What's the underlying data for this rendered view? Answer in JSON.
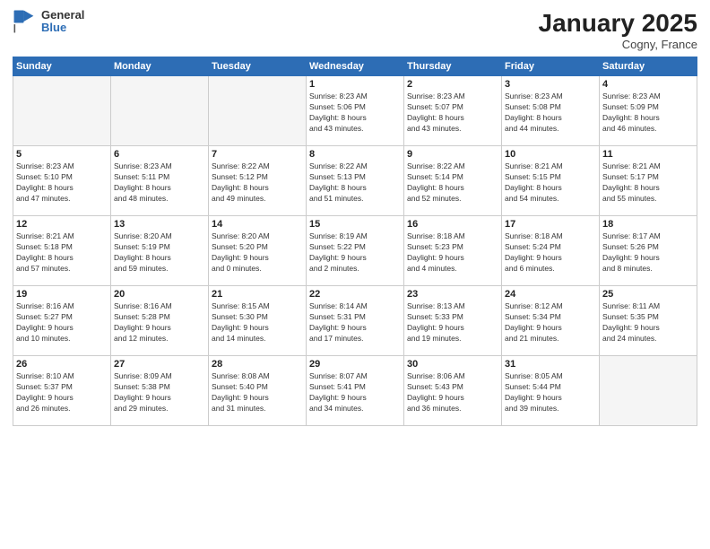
{
  "header": {
    "logo_general": "General",
    "logo_blue": "Blue",
    "month_title": "January 2025",
    "location": "Cogny, France"
  },
  "weekdays": [
    "Sunday",
    "Monday",
    "Tuesday",
    "Wednesday",
    "Thursday",
    "Friday",
    "Saturday"
  ],
  "weeks": [
    [
      {
        "day": "",
        "info": ""
      },
      {
        "day": "",
        "info": ""
      },
      {
        "day": "",
        "info": ""
      },
      {
        "day": "1",
        "info": "Sunrise: 8:23 AM\nSunset: 5:06 PM\nDaylight: 8 hours\nand 43 minutes."
      },
      {
        "day": "2",
        "info": "Sunrise: 8:23 AM\nSunset: 5:07 PM\nDaylight: 8 hours\nand 43 minutes."
      },
      {
        "day": "3",
        "info": "Sunrise: 8:23 AM\nSunset: 5:08 PM\nDaylight: 8 hours\nand 44 minutes."
      },
      {
        "day": "4",
        "info": "Sunrise: 8:23 AM\nSunset: 5:09 PM\nDaylight: 8 hours\nand 46 minutes."
      }
    ],
    [
      {
        "day": "5",
        "info": "Sunrise: 8:23 AM\nSunset: 5:10 PM\nDaylight: 8 hours\nand 47 minutes."
      },
      {
        "day": "6",
        "info": "Sunrise: 8:23 AM\nSunset: 5:11 PM\nDaylight: 8 hours\nand 48 minutes."
      },
      {
        "day": "7",
        "info": "Sunrise: 8:22 AM\nSunset: 5:12 PM\nDaylight: 8 hours\nand 49 minutes."
      },
      {
        "day": "8",
        "info": "Sunrise: 8:22 AM\nSunset: 5:13 PM\nDaylight: 8 hours\nand 51 minutes."
      },
      {
        "day": "9",
        "info": "Sunrise: 8:22 AM\nSunset: 5:14 PM\nDaylight: 8 hours\nand 52 minutes."
      },
      {
        "day": "10",
        "info": "Sunrise: 8:21 AM\nSunset: 5:15 PM\nDaylight: 8 hours\nand 54 minutes."
      },
      {
        "day": "11",
        "info": "Sunrise: 8:21 AM\nSunset: 5:17 PM\nDaylight: 8 hours\nand 55 minutes."
      }
    ],
    [
      {
        "day": "12",
        "info": "Sunrise: 8:21 AM\nSunset: 5:18 PM\nDaylight: 8 hours\nand 57 minutes."
      },
      {
        "day": "13",
        "info": "Sunrise: 8:20 AM\nSunset: 5:19 PM\nDaylight: 8 hours\nand 59 minutes."
      },
      {
        "day": "14",
        "info": "Sunrise: 8:20 AM\nSunset: 5:20 PM\nDaylight: 9 hours\nand 0 minutes."
      },
      {
        "day": "15",
        "info": "Sunrise: 8:19 AM\nSunset: 5:22 PM\nDaylight: 9 hours\nand 2 minutes."
      },
      {
        "day": "16",
        "info": "Sunrise: 8:18 AM\nSunset: 5:23 PM\nDaylight: 9 hours\nand 4 minutes."
      },
      {
        "day": "17",
        "info": "Sunrise: 8:18 AM\nSunset: 5:24 PM\nDaylight: 9 hours\nand 6 minutes."
      },
      {
        "day": "18",
        "info": "Sunrise: 8:17 AM\nSunset: 5:26 PM\nDaylight: 9 hours\nand 8 minutes."
      }
    ],
    [
      {
        "day": "19",
        "info": "Sunrise: 8:16 AM\nSunset: 5:27 PM\nDaylight: 9 hours\nand 10 minutes."
      },
      {
        "day": "20",
        "info": "Sunrise: 8:16 AM\nSunset: 5:28 PM\nDaylight: 9 hours\nand 12 minutes."
      },
      {
        "day": "21",
        "info": "Sunrise: 8:15 AM\nSunset: 5:30 PM\nDaylight: 9 hours\nand 14 minutes."
      },
      {
        "day": "22",
        "info": "Sunrise: 8:14 AM\nSunset: 5:31 PM\nDaylight: 9 hours\nand 17 minutes."
      },
      {
        "day": "23",
        "info": "Sunrise: 8:13 AM\nSunset: 5:33 PM\nDaylight: 9 hours\nand 19 minutes."
      },
      {
        "day": "24",
        "info": "Sunrise: 8:12 AM\nSunset: 5:34 PM\nDaylight: 9 hours\nand 21 minutes."
      },
      {
        "day": "25",
        "info": "Sunrise: 8:11 AM\nSunset: 5:35 PM\nDaylight: 9 hours\nand 24 minutes."
      }
    ],
    [
      {
        "day": "26",
        "info": "Sunrise: 8:10 AM\nSunset: 5:37 PM\nDaylight: 9 hours\nand 26 minutes."
      },
      {
        "day": "27",
        "info": "Sunrise: 8:09 AM\nSunset: 5:38 PM\nDaylight: 9 hours\nand 29 minutes."
      },
      {
        "day": "28",
        "info": "Sunrise: 8:08 AM\nSunset: 5:40 PM\nDaylight: 9 hours\nand 31 minutes."
      },
      {
        "day": "29",
        "info": "Sunrise: 8:07 AM\nSunset: 5:41 PM\nDaylight: 9 hours\nand 34 minutes."
      },
      {
        "day": "30",
        "info": "Sunrise: 8:06 AM\nSunset: 5:43 PM\nDaylight: 9 hours\nand 36 minutes."
      },
      {
        "day": "31",
        "info": "Sunrise: 8:05 AM\nSunset: 5:44 PM\nDaylight: 9 hours\nand 39 minutes."
      },
      {
        "day": "",
        "info": ""
      }
    ]
  ]
}
